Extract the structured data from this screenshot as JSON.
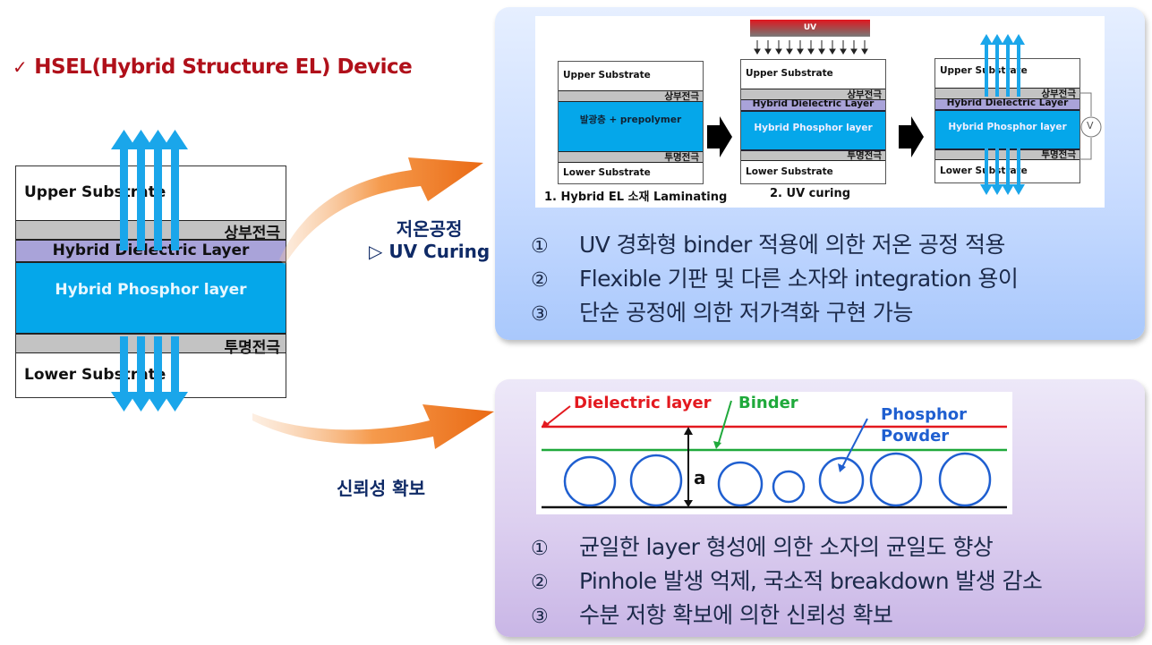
{
  "title": {
    "check_icon": "✓",
    "text": "HSEL(Hybrid Structure EL) Device"
  },
  "main_stack": {
    "upper_substrate": "Upper Substrate",
    "upper_electrode": "상부전극",
    "dielectric": "Hybrid Dielectric Layer",
    "phosphor": "Hybrid Phosphor layer",
    "lower_electrode": "투명전극",
    "lower_substrate": "Lower Substrate"
  },
  "arrow_labels": {
    "top_line1": "저온공정",
    "top_line2": "▷ UV Curing",
    "bottom": "신뢰성 확보"
  },
  "process_figure": {
    "step1": {
      "upper_substrate": "Upper Substrate",
      "upper_electrode": "상부전극",
      "middle": "발광층 + prepolymer",
      "lower_electrode": "투명전극",
      "lower_substrate": "Lower Substrate",
      "caption": "1. Hybrid EL 소재 Laminating"
    },
    "step2": {
      "uv_label": "UV",
      "upper_substrate": "Upper Substrate",
      "upper_electrode": "상부전극",
      "dielectric": "Hybrid Dielectric Layer",
      "phosphor": "Hybrid Phosphor layer",
      "lower_electrode": "투명전극",
      "lower_substrate": "Lower Substrate",
      "caption": "2. UV curing"
    },
    "step3": {
      "upper_substrate": "Upper Substrate",
      "upper_electrode": "상부전극",
      "dielectric": "Hybrid Dielectric Layer",
      "phosphor": "Hybrid Phosphor layer",
      "lower_electrode": "투명전극",
      "lower_substrate": "Lower Substrate",
      "voltage_symbol": "V"
    }
  },
  "top_panel_bullets": [
    {
      "num": "①",
      "text": "UV 경화형 binder 적용에 의한 저온 공정 적용"
    },
    {
      "num": "②",
      "text": "Flexible 기판 및 다른 소자와 integration 용이"
    },
    {
      "num": "③",
      "text": "단순 공정에 의한 저가격화 구현 가능"
    }
  ],
  "structure_figure": {
    "dielectric_label": "Dielectric layer",
    "binder_label": "Binder",
    "phosphor_label_line1": "Phosphor",
    "phosphor_label_line2": "Powder",
    "thickness_label": "a"
  },
  "bottom_panel_bullets": [
    {
      "num": "①",
      "text": "균일한 layer 형성에 의한 소자의 균일도 향상"
    },
    {
      "num": "②",
      "text": "Pinhole 발생 억제, 국소적 breakdown 발생 감소"
    },
    {
      "num": "③",
      "text": "수분 저항 확보에 의한 신뢰성 확보"
    }
  ],
  "colors": {
    "title_red": "#b0101a",
    "phosphor_blue": "#05a7ea",
    "dielectric_purple": "#a9a3d9",
    "electrode_gray": "#c3c3c3",
    "light_arrow_blue": "#1aa6ea",
    "orange_arrow": "#f07a1e",
    "dielectric_line_red": "#e3191f",
    "binder_line_green": "#1fa93b",
    "powder_blue": "#1f5fd0"
  }
}
